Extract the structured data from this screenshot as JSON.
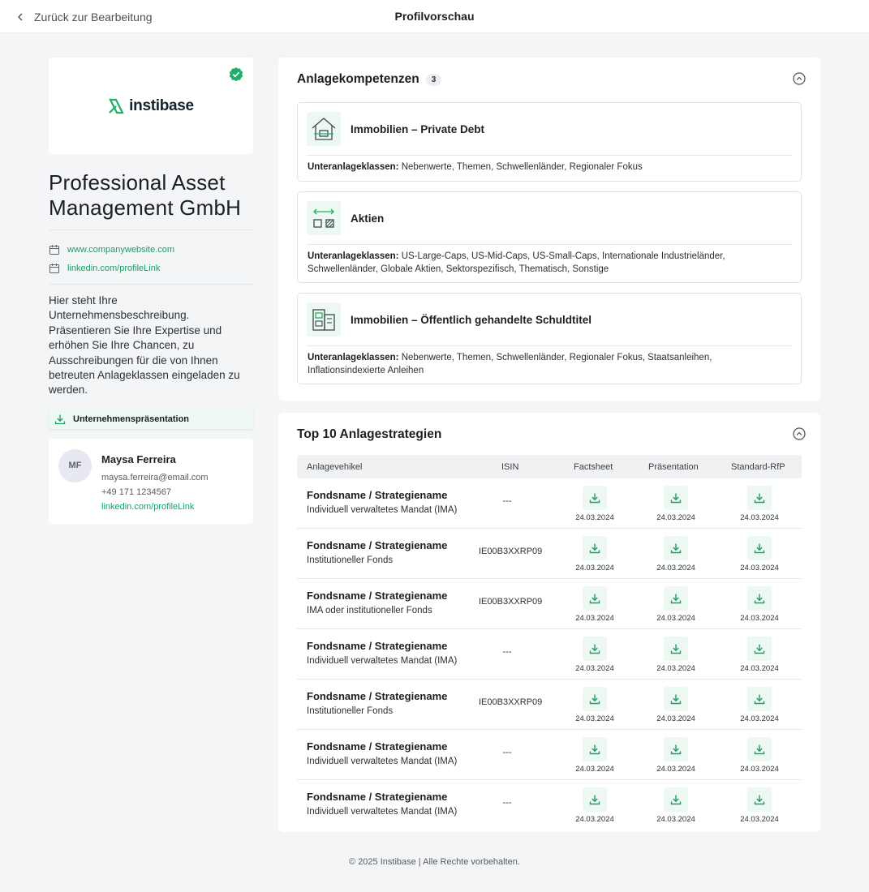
{
  "topbar": {
    "back_label": "Zurück zur Bearbeitung",
    "page_title": "Profilvorschau"
  },
  "profile": {
    "logo_text": "instibase",
    "company_name": "Professional Asset Management GmbH",
    "website": "www.companywebsite.com",
    "linkedin": "linkedin.com/profileLink",
    "description": "Hier steht Ihre Unternehmensbeschreibung. Präsentieren Sie Ihre Expertise und erhöhen Sie Ihre Chancen, zu Ausschreibungen für die von Ihnen betreuten Anlageklassen eingeladen zu werden.",
    "presentation_button": "Unternehmenspräsentation",
    "contact": {
      "initials": "MF",
      "name": "Maysa Ferreira",
      "email": "maysa.ferreira@email.com",
      "phone": "+49 171 1234567",
      "linkedin": "linkedin.com/profileLink"
    }
  },
  "competencies": {
    "title": "Anlagekompetenzen",
    "count": "3",
    "sublabel": "Unteranlageklassen:",
    "items": [
      {
        "title": "Immobilien – Private Debt",
        "icon": "house-icon",
        "sub": "Nebenwerte, Themen, Schwellenländer, Regionaler Fokus"
      },
      {
        "title": "Aktien",
        "icon": "exchange-icon",
        "sub": "US-Large-Caps, US-Mid-Caps, US-Small-Caps, Internationale Industrieländer, Schwellenländer, Globale Aktien, Sektorspezifisch, Thematisch, Sonstige"
      },
      {
        "title": "Immobilien – Öffentlich gehandelte Schuldtitel",
        "icon": "building-icon",
        "sub": "Nebenwerte, Themen, Schwellenländer, Regionaler Fokus, Staatsanleihen, Inflationsindexierte Anleihen"
      }
    ]
  },
  "strategies": {
    "title": "Top 10 Anlagestrategien",
    "columns": [
      "Anlagevehikel",
      "ISIN",
      "Factsheet",
      "Präsentation",
      "Standard-RfP"
    ],
    "rows": [
      {
        "name": "Fondsname / Strategiename",
        "type": "Individuell verwaltetes Mandat (IMA)",
        "isin": "---",
        "factsheet": "24.03.2024",
        "presentation": "24.03.2024",
        "rfp": "24.03.2024"
      },
      {
        "name": "Fondsname / Strategiename",
        "type": "Institutioneller Fonds",
        "isin": "IE00B3XXRP09",
        "factsheet": "24.03.2024",
        "presentation": "24.03.2024",
        "rfp": "24.03.2024"
      },
      {
        "name": "Fondsname / Strategiename",
        "type": "IMA oder institutioneller Fonds",
        "isin": "IE00B3XXRP09",
        "factsheet": "24.03.2024",
        "presentation": "24.03.2024",
        "rfp": "24.03.2024"
      },
      {
        "name": "Fondsname / Strategiename",
        "type": "Individuell verwaltetes Mandat (IMA)",
        "isin": "---",
        "factsheet": "24.03.2024",
        "presentation": "24.03.2024",
        "rfp": "24.03.2024"
      },
      {
        "name": "Fondsname / Strategiename",
        "type": "Institutioneller Fonds",
        "isin": "IE00B3XXRP09",
        "factsheet": "24.03.2024",
        "presentation": "24.03.2024",
        "rfp": "24.03.2024"
      },
      {
        "name": "Fondsname / Strategiename",
        "type": "Individuell verwaltetes Mandat (IMA)",
        "isin": "---",
        "factsheet": "24.03.2024",
        "presentation": "24.03.2024",
        "rfp": "24.03.2024"
      },
      {
        "name": "Fondsname / Strategiename",
        "type": "Individuell verwaltetes Mandat (IMA)",
        "isin": "---",
        "factsheet": "24.03.2024",
        "presentation": "24.03.2024",
        "rfp": "24.03.2024"
      }
    ]
  },
  "footer": {
    "text": "© 2025 Instibase  |  Alle Rechte vorbehalten."
  },
  "colors": {
    "accent": "#1f9d63",
    "accent_bg": "#eef8f2",
    "page_bg": "#f4f5f6"
  }
}
